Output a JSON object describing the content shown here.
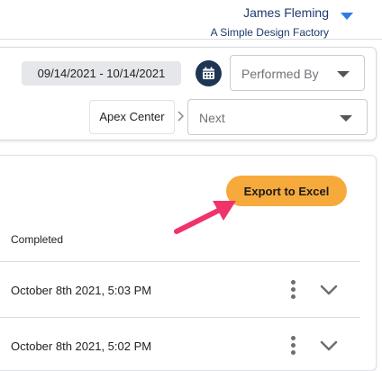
{
  "header": {
    "user_name": "James Fleming",
    "org_name": "A Simple Design Factory"
  },
  "filters": {
    "date_range": "09/14/2021 - 10/14/2021",
    "performed_by_placeholder": "Performed By",
    "location": "Apex Center",
    "next_placeholder": "Next"
  },
  "main": {
    "export_label": "Export to Excel",
    "column_header": "Completed",
    "rows": [
      {
        "completed": "October 8th 2021, 5:03 PM"
      },
      {
        "completed": "October 8th 2021, 5:02 PM"
      }
    ]
  },
  "colors": {
    "accent": "#f6aa3c",
    "navy": "#1e3553",
    "link_blue": "#1e3a6e",
    "caret_blue": "#2c7be5",
    "annotation_pink": "#f0336b"
  }
}
